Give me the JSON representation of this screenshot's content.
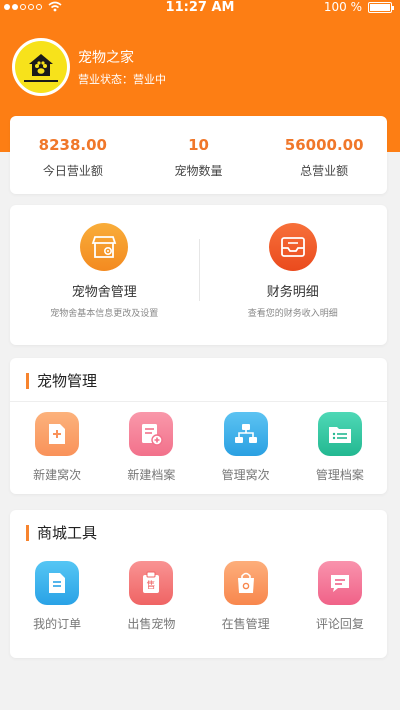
{
  "status_bar": {
    "time": "11:27 AM",
    "battery": "100 %"
  },
  "store": {
    "name": "宠物之家",
    "status": "营业状态：营业中"
  },
  "stats": [
    {
      "value": "8238.00",
      "label": "今日营业额"
    },
    {
      "value": "10",
      "label": "宠物数量"
    },
    {
      "value": "56000.00",
      "label": "总营业额"
    }
  ],
  "management": [
    {
      "title": "宠物舍管理",
      "subtitle": "宠物舍基本信息更改及设置",
      "icon": "storefront-gear-icon",
      "color": "#f59a2a"
    },
    {
      "title": "财务明细",
      "subtitle": "查看您的财务收入明细",
      "icon": "inbox-tray-icon",
      "color": "#f05a28"
    }
  ],
  "pet_management": {
    "title": "宠物管理",
    "items": [
      {
        "label": "新建窝次",
        "icon": "new-document-icon",
        "color": "#fba56e"
      },
      {
        "label": "新建档案",
        "icon": "new-file-icon",
        "color": "#f5869c"
      },
      {
        "label": "管理窝次",
        "icon": "hierarchy-icon",
        "color": "#3fb1ea"
      },
      {
        "label": "管理档案",
        "icon": "folder-list-icon",
        "color": "#33c9a6"
      }
    ]
  },
  "mall_tools": {
    "title": "商城工具",
    "items": [
      {
        "label": "我的订单",
        "icon": "order-document-icon",
        "color": "#38b5ec"
      },
      {
        "label": "出售宠物",
        "icon": "sell-tag-icon",
        "color": "#f47c7c"
      },
      {
        "label": "在售管理",
        "icon": "shopping-bag-icon",
        "color": "#fb9a66"
      },
      {
        "label": "评论回复",
        "icon": "comment-icon",
        "color": "#f57a98"
      }
    ]
  }
}
